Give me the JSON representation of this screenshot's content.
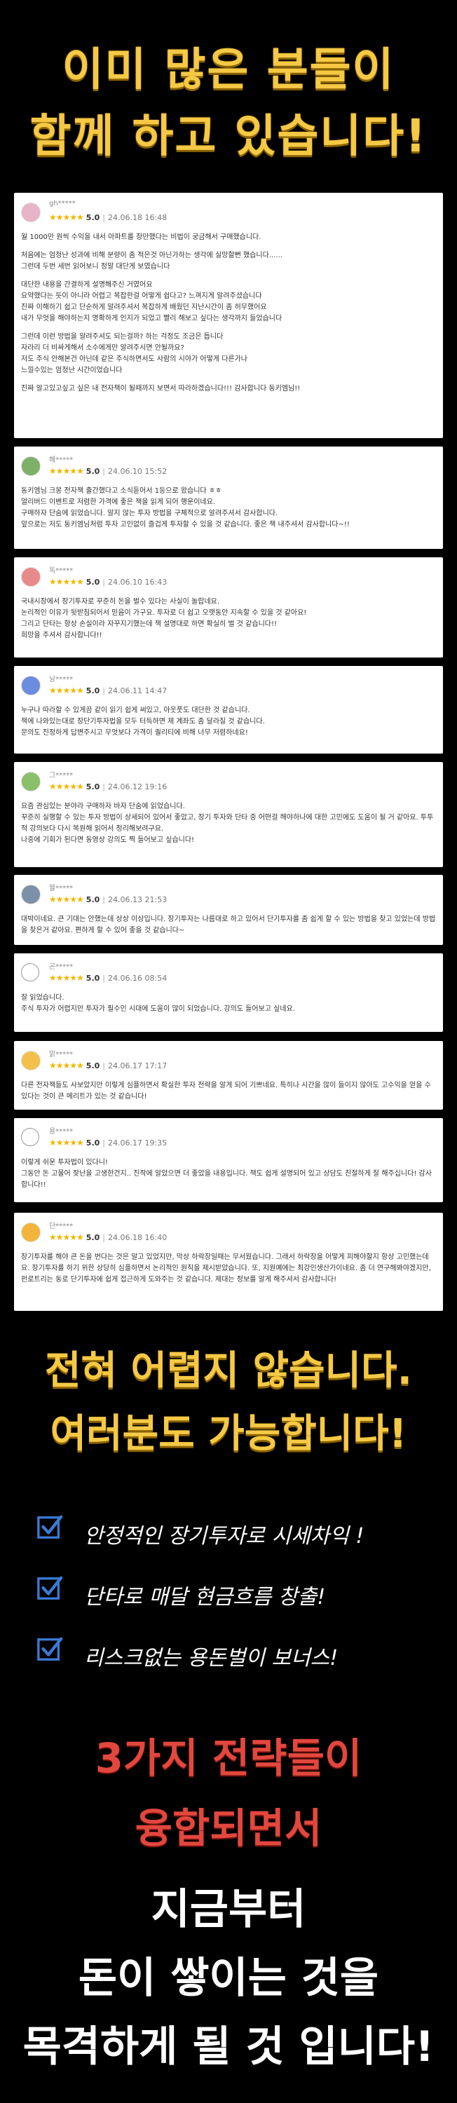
{
  "hero": {
    "line1": "이미 많은 분들이",
    "line2": "함께 하고 있습니다!"
  },
  "reviews": [
    {
      "name": "gh*****",
      "stars": "★★★★★",
      "score": "5.0",
      "date": "24.06.18 16:48",
      "lines": [
        "월 1000만 원씩 수익을 내서 아파트를 장만했다는 비법이 궁금해서 구매했습니다.",
        "",
        "처음에는 엄청난 성과에 비해 분량이 좀 적은것 아닌가하는 생각에 실망할뻔 했습니다......",
        "그런데 두번 세번 읽어보니 정말 대단게 보였습니다",
        "",
        "대단한 내용을 간결하게 설명해주신 거였어요",
        "요약했다는 듯이 아니라 어렵고 복잡한걸 어떻게 쉽다고? 느껴지게 알려주셨습니다",
        "진짜 이해하기 쉽고 단순하게 알려주셔서 복잡하게 배웠던 지난시간이 좀 허무했어요",
        "내가 무엇을 해야하는지 명확하게 인지가 되었고 빨리 해보고 싶다는 생각까지 들었습니다",
        "",
        "그런데 이런 방법을 알려주셔도 되는걸까? 하는 걱정도 조금은 듭니다",
        "자라리 더 비싸게해서 소수에게만 알려주시면 안될까요?",
        "저도 주식 안해본건 아닌데 같은 주식하면서도 사람의 시야가 어떻게 다른가나",
        "느낄수있는 엄청난 시간이었습니다",
        "",
        "진짜 알고있고싶고 싶은 내 전자책이 될때까지 보면서 따라하겠습니다!!! 감사합니다 동키엠님!!"
      ]
    },
    {
      "name": "혜*****",
      "stars": "★★★★★",
      "score": "5.0",
      "date": "24.06.10 15:52",
      "lines": [
        "동키엠님 크몽 전자책 출간했다고 소식듣어서 1등으로 왔습니다 ㅎㅎ",
        "얼리버드 이벤트로 저렴한 가격에 좋은 책을 읽게 되어 행운이네요.",
        "구매하자 단숨에 읽었습니다. 알지 않는 투자 방법을 구체적으로 알려주셔서 감사합니다.",
        "앞으로는 저도 동키엠님처럼 투자 고인없이 즐겁게 투자할 수 있을 것 같습니다. 좋은 책 내주셔서 감사합니다~!!"
      ]
    },
    {
      "name": "독*****",
      "stars": "★★★★★",
      "score": "5.0",
      "date": "24.06.10 16:43",
      "lines": [
        "국내시장에서 장기투자로 꾸준히 돈을 벌수 있다는 사실이 놀랍네요.",
        "논리적인 이유가 뒷받침되어서 믿음이 가구요. 투자로 더 쉽고 오랫동안 지속할 수 있을 것 같아요!",
        "그리고 단타는 항상 손실이라 자꾸지기했는데 책 설명대로 하면 확실히 벌 것 같습니다!!",
        "희망을 주셔서 감사합니다!!"
      ]
    },
    {
      "name": "낭*****",
      "stars": "★★★★★",
      "score": "5.0",
      "date": "24.06.11 14:47",
      "lines": [
        "누구나 따라할 수 있게끔 같이 읽기 쉽게 써있고, 아웃풋도 대단한 것 같습니다.",
        "책에 나와있는대로 장단기투자법을 모두 터득하면 제 계좌도 좀 달라질 것 같습니다.",
        "문의도 진정하게 답변주시고 무엇보다 가격이 퀄리티에 비해 너무 저렴하네요!"
      ]
    },
    {
      "name": "그*****",
      "stars": "★★★★★",
      "score": "5.0",
      "date": "24.06.12 19:16",
      "lines": [
        "요즘 관심있는 분야라 구매하자 바자 단숨에 읽었습니다.",
        "꾸준히 실행할 수 있는 투자 방법이 상세되어 있어서 좋았고, 장기 투자와 단타 중 어떤걸 해야하나에 대한 고민에도 도움이 될 거 같아요. 투투적 강의보다 다시 복원해 읽어서 정리해보려구요.",
        "나중에 기회가 된다면 동영상 강의도 찍 들어보고 싶습니다!"
      ]
    },
    {
      "name": "블*****",
      "stars": "★★★★★",
      "score": "5.0",
      "date": "24.06.13 21:53",
      "lines": [
        "대박이네요. 큰 기대는 안했는데 상상 이상입니다. 장기투자는 나름대로 하고 있어서 단기투자를 좀 쉽게 할 수 있는 방법을 찾고 있었는데 방법을 찾은거 같아요. 편하게 할 수 있어 좋을 것 같습니다~"
      ]
    },
    {
      "name": "곤*****",
      "stars": "★★★★★",
      "score": "5.0",
      "date": "24.06.16 08:54",
      "lines": [
        "잘 읽었습니다.",
        "주식 투자가 어렵지만 투자가 필수인 시대에 도움이 많이 되었습니다. 강의도 들어보고 싶네요."
      ]
    },
    {
      "name": "맑*****",
      "stars": "★★★★★",
      "score": "5.0",
      "date": "24.06.17 17:17",
      "lines": [
        "다른 전자책들도 사보았지만 이렇게 심플하면서 확실한 투자 전략을 알게 되어 기쁘네요. 특히나 시간을 많이 들이지 않아도 고수익을 얻을 수 있다는 것이 큰 메리트가 있는 것 같습니다!"
      ]
    },
    {
      "name": "용*****",
      "stars": "★★★★★",
      "score": "5.0",
      "date": "24.06.17 19:35",
      "lines": [
        "이렇게 쉬운 투자법이 있다니!",
        "그동안 돈 고물어 잦난을 고생한건지.. 진작에 알았으면 더 좋았을 내용입니다. 책도 쉽게 설명되어 있고 상담도 친절하게 잘 해주십니다! 감사합니다!!"
      ]
    },
    {
      "name": "단*****",
      "stars": "★★★★★",
      "score": "5.0",
      "date": "24.06.18 16:40",
      "lines": [
        "장기투자를 해야 큰 돈을 번다는 것은 알고 있었지만, 막상 하락장일때는 무서웠습니다. 그래서 하락장을 어떻게 피해야할지 항상 고민했는데요. 장기투자를 하기 위한 상당히 심플하면서 논리적인 원칙을 제시받았습니다. 또, 지원예에는 최강인생산가이네요. 좀 더 연구해봐야겠지만, 펀로트리는 동로 단기투자에 쉽게 접근하게 도와주는 것 같습니다. 제대는 정보를 알게 해주셔서 감사합니다!"
      ]
    }
  ],
  "middle": {
    "line1": "전혀 어렵지 않습니다.",
    "line2": "여러분도 가능합니다!"
  },
  "checks": [
    "안정적인 장기투자로 시세차익 !",
    "단타로 매달 현금흐름 창출!",
    "리스크없는 용돈벌이 보너스!"
  ],
  "red": {
    "line1": "3가지 전략들이",
    "line2": "융합되면서"
  },
  "final": {
    "line1": "지금부터",
    "line2": "돈이 쌓이는 것을",
    "line3": "목격하게 될 것 입니다!"
  },
  "colors": {
    "gold": "#f6c945",
    "red": "#e2473d",
    "check": "#3a7bd5",
    "star": "#f2b700"
  }
}
